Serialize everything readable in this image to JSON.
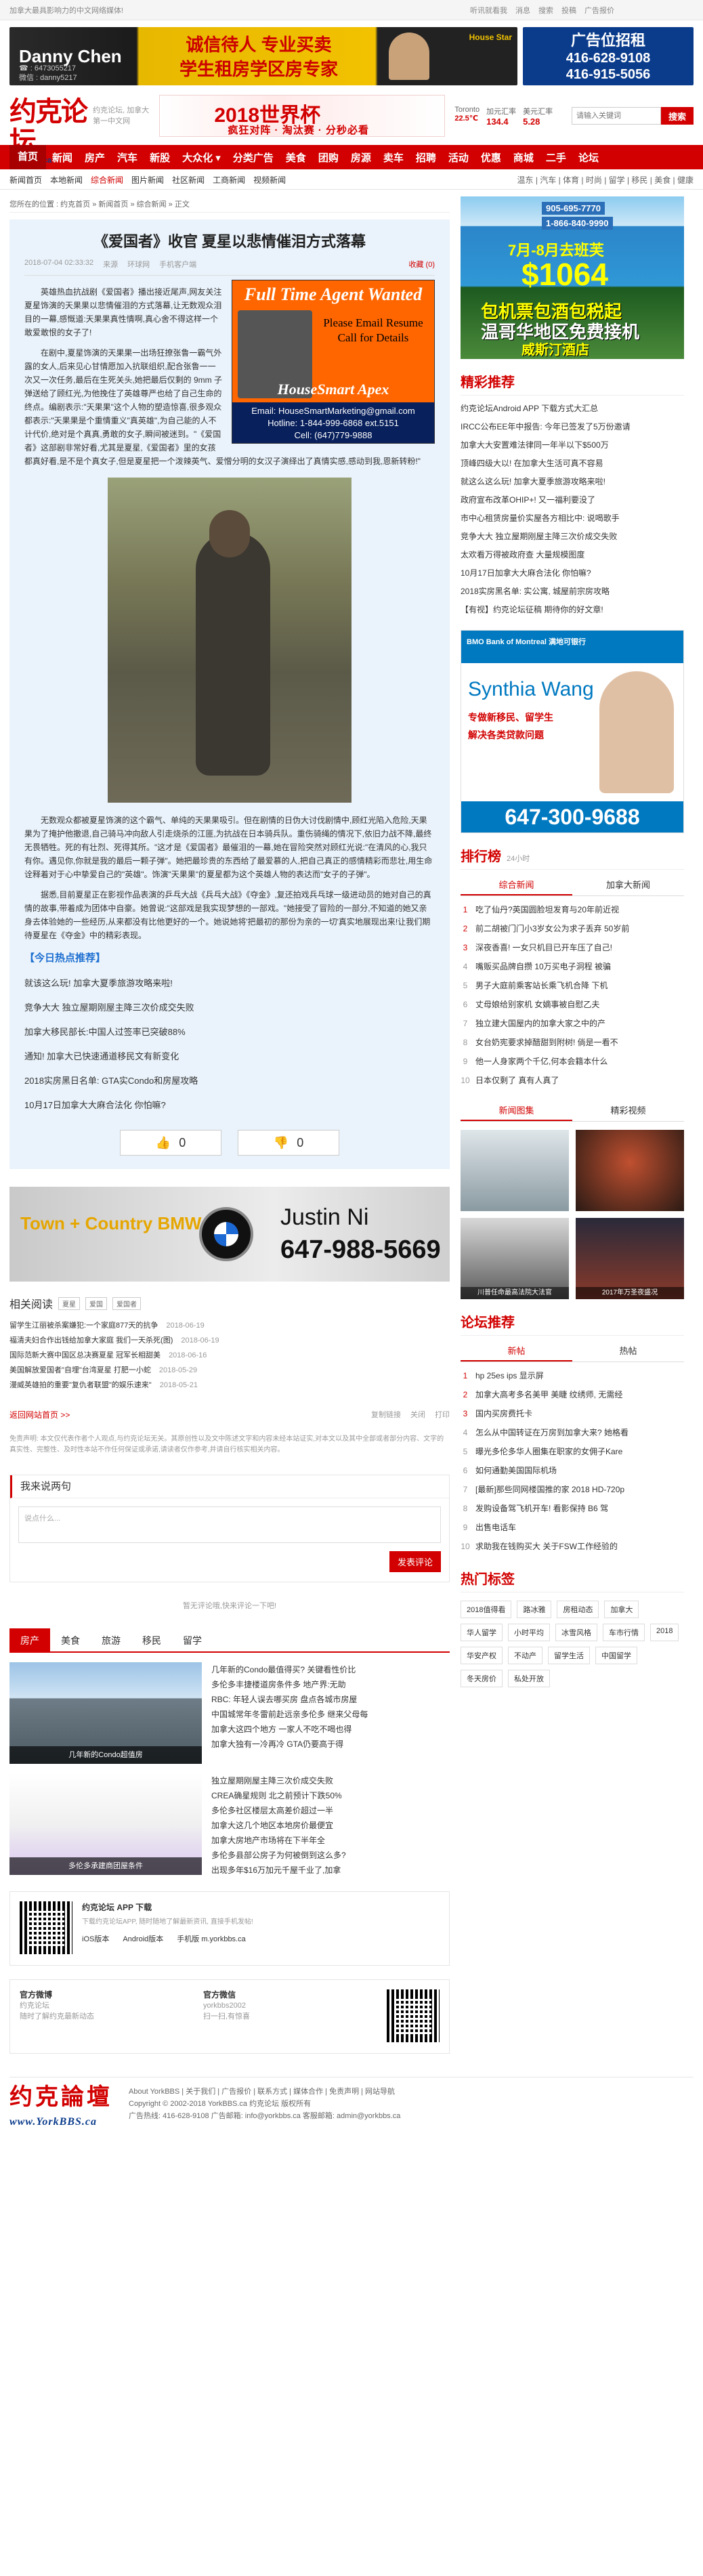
{
  "topbar": {
    "left": "加拿大最具影响力的中文网络媒体!",
    "links": [
      "听讯就看我",
      "消息",
      "搜索",
      "投稿",
      "广告报价"
    ]
  },
  "top_ads": {
    "danny_name": "Danny Chen",
    "danny_phone": "☎ : 6473055217",
    "danny_wechat": "微信 : danny5217",
    "danny_slogan1": "诚信待人 专业买卖",
    "danny_slogan2": "学生租房学区房专家",
    "danny_tag": "House Star",
    "ad_title": "广告位招租",
    "ad_tel1": "416-628-9108",
    "ad_tel2": "416-915-5056"
  },
  "header": {
    "logo": "约克论坛",
    "logo_sub": "YorkBBS.ca",
    "slogan1": "约克论坛, 加拿大第一中文网",
    "worldcup_title": "2018世界杯",
    "worldcup_sub": "疯狂对阵 · 淘汰赛 · 分秒必看",
    "city": "Toronto",
    "temp": "22.5℃",
    "cad_label": "加元汇率",
    "cad_val": "134.4",
    "usd_label": "美元汇率",
    "usd_val": "5.28",
    "search_placeholder": "请输入关键词",
    "search_button": "搜索"
  },
  "nav": [
    "首页",
    "新闻",
    "房产",
    "汽车",
    "新股",
    "大众化 ▾",
    "分类广告",
    "美食",
    "团购",
    "房源",
    "卖车",
    "招聘",
    "活动",
    "优惠",
    "商城",
    "二手",
    "论坛"
  ],
  "subnav": {
    "items": [
      "新闻首页",
      "本地新闻",
      "综合新闻",
      "图片新闻",
      "社区新闻",
      "工商新闻",
      "视频新闻"
    ],
    "active": 2,
    "right": "温东 | 汽车 | 体育 | 时尚 | 留学 | 移民 | 美食 | 健康"
  },
  "crumb": "您所在的位置 : 约克首页 » 新闻首页 » 综合新闻 » 正文",
  "article": {
    "title": "《爱国者》收官 夏星以悲情催泪方式落幕",
    "date": "2018-07-04 02:33:32",
    "source": "来源",
    "author": "环球网",
    "mobile": "手机客户端",
    "fav": "收藏 (0)",
    "agent": {
      "title": "Full Time Agent Wanted",
      "right": "Please Email Resume Call for Details",
      "brand": "HouseSmart Apex",
      "brand_sub": "Realty Inc, Brokerage",
      "email": "Email: HouseSmartMarketing@gmail.com",
      "hotline": "Hotline: 1-844-999-6868 ext.5151",
      "cell": "Cell: (647)779-9888"
    },
    "p1": "英雄热血抗战剧《爱国者》播出接近尾声,网友关注夏星饰演的天果果以悲情催泪的方式落幕,让无数观众泪目的一幕,感慨道:天果果真性情啊,真心舍不得这样一个敢爱敢恨的女子了!",
    "p2": "在剧中,夏星饰演的天果果一出场狂撩张鲁一霸气外露的女人,后来见心甘情愿加入抗联组织,配合张鲁一一次又一次任务,最后在生死关头,她把最后仅剩的 9mm 子弹送给了顾红光,为他挽住了英雄尊严也给了自己生命的终点。编剧表示:\"天果果\"这个人物的塑造惊喜,很多观众都表示:\"天果果是个重情重义\"真英雄\",为自己能的人不计代价,绝对是个真真,勇敢的女子,瞬间被迷到。\"《爱国者》这部剧非常好看,尤其是夏星,《爱国者》里的女孩都真好看,是不是个真女子,但是夏星把一个泼辣英气、爱憎分明的女汉子演绎出了真情实感,感动到我,恩新转粉!\"",
    "p3": "无数观众都被夏星饰演的这个霸气、单纯的天果果吸引。但在剧情的日伪大讨伐剧情中,顾红光陷入危险,天果果为了掩护他撤退,自己骑马冲向敌人引走烧杀的江匪,为抗战在日本骑兵队。重伤骑绳的情况下,依旧力战不降,最终无畏牺牲。死的有壮烈、死得其所。\"这才是《爱国者》最催泪的一幕,她在冒险突然对顾红光说:\"在清风的心,我只有你。遇见你,你就是我的最后一颗子弹\"。她把最珍贵的东西给了最爱慕的人,把自己真正的感情精彩而悲壮,用生命诠释着对于心中挚爱自己的\"英雄\"。饰演\"天果果\"的夏星都为这个英雄人物的表达而\"女子的子弹\"。",
    "p4": "据悉,目前夏星正在影视作品表演的乒乓大战《兵乓大战》《夺金》,复还拍戏兵乓球一级进动员的她对自己的真情的故事,带着成为团体中自豪。她曾说:\"这部戏是我实现梦想的一部戏。\"她接受了冒险的一部分,不知道的她又亲身去体验她的一些经历,从来都没有比他更好的一个。她说她将'把最初的那份为亲的一切'真实地展现出来!让我们期待夏星在《夺金》中的精彩表现。",
    "hot_title": "【今日热点推荐】",
    "hot": [
      "就该这么玩! 加拿大夏季旅游攻略来啦!",
      "竞争大大 独立屋期刚屋主降三次价成交失败",
      "加拿大移民部长:中国人过签率已突破88%",
      "通知! 加拿大已快速通道移民文有新变化",
      "2018实房黑日名单: GTA实Condo和房屋攻略",
      "10月17日加拿大大麻合法化 你怕嘛?"
    ],
    "like": "0",
    "dislike": "0"
  },
  "bmw": {
    "dealer": "Town + Country BMW",
    "name": "Justin Ni",
    "tel": "647-988-5669"
  },
  "related": {
    "title": "相关阅读",
    "tags": [
      "夏星",
      "爱国",
      "爱国者"
    ],
    "items": [
      {
        "t": "留学生江丽被杀案嫌犯:一个家庭877天的抗争",
        "d": "2018-06-19"
      },
      {
        "t": "福清夫妇合作出钱给加拿大家庭 我们一天杀死(图)",
        "d": "2018-06-19"
      },
      {
        "t": "国际范新大赛中国区总决赛夏星 冠军长相甜美",
        "d": "2018-06-16"
      },
      {
        "t": "美国解放爱国者\"自埋\"台湾夏星 打肥一小蛇",
        "d": "2018-05-29"
      },
      {
        "t": "漫威英雄拍的重要\"复仇者联盟\"的娱乐速来\"",
        "d": "2018-05-21"
      }
    ]
  },
  "back": {
    "left": "返回网站首页 >>",
    "share": "复制链接",
    "close": "关闭",
    "print": "打印"
  },
  "note": "免责声明: 本文仅代表作者个人观点,与约克论坛无关。其原创性以及文中陈述文字和内容未经本站证实,对本文以及其中全部或者部分内容、文字的真实性、完整性、及时性本站不作任何保证或承诺,请读者仅作参考,并请自行核实相关内容。",
  "comment": {
    "title": "我来说两句",
    "placeholder": "说点什么...",
    "submit": "发表评论",
    "empty": "暂无评论哦,快来评论一下吧!"
  },
  "feed": {
    "tabs": [
      "房产",
      "美食",
      "旅游",
      "移民",
      "留学"
    ],
    "active": 0,
    "blocks": [
      {
        "cap": "几年新的Condo超值房",
        "items": [
          "几年新的Condo最值得买? 关键看性价比",
          "多伦多丰捷楼道房条件多 地产界:无助",
          "RBC: 年轻人误去哪买房 盘点各城市房屋",
          "中国城常年冬雷前赴远亲多伦多 继来父母每",
          "加拿大这四个地方 一家人不吃不喝也得",
          "加拿大独有一冷再冷 GTA仍要高于得"
        ]
      },
      {
        "cap": "多伦多承建商团屋条件",
        "items": [
          "独立屋期刚屋主降三次价成交失败",
          "CREA确星规则 北之前预计下跌50%",
          "多伦多社区楼层太高差价超过一半",
          "加拿大这几个地区本地房价最便宜",
          "加拿大房地产市场将在下半年全",
          "多伦多县部公房子为何被倒到这么多?",
          "出现多年$16万加元千屋千业了,加拿"
        ]
      }
    ]
  },
  "app": {
    "title": "约克论坛 APP 下载",
    "desc": "下载约克论坛APP, 随时随地了解最新资讯, 直接手机发帖!",
    "ios": "iOS版本",
    "android": "Android版本",
    "mobile": "手机版 m.yorkbbs.ca"
  },
  "social": {
    "weibo_t": "官方微博",
    "weibo_a": "约克论坛",
    "weibo_d": "随时了解约克最新动态",
    "wx_t": "官方微信",
    "wx_a": "yorkbbs2002",
    "wx_d": "扫一扫,有惊喜"
  },
  "footer": {
    "logo": "约克論壇",
    "logo_sub": "www.YorkBBS.ca",
    "links": "About YorkBBS | 关于我们 | 广告报价 | 联系方式 | 媒体合作 | 免责声明 | 网站导航",
    "copy": "Copyright © 2002-2018 YorkBBS.ca 约克论坛 版权所有",
    "contact": "广告热线: 416-628-9108   广告邮箱: info@yorkbbs.ca   客服邮箱: admin@yorkbbs.ca"
  },
  "side": {
    "ad1": {
      "p1": "905-695-7770",
      "p2": "1-866-840-9990",
      "dates": "7月-8月去班芙",
      "price": "$1064",
      "t1": "包机票包酒包税起",
      "t2": "温哥华地区免费接机",
      "t3": "威斯汀酒店"
    },
    "rec_title": "精彩推荐",
    "rec": [
      "约克论坛Android APP 下载方式大汇总",
      "IRCC公布EE年中报告: 今年已签发了5万份邀请",
      "加拿大大安置难法律同一年半以下$500万",
      "顶峰四级大以! 在加拿大生活可真不容易",
      "就这么这么玩! 加拿大夏季旅游攻略来啦!",
      "政府宣布改革OHIP+! 又一福利要没了",
      "市中心租赁房量价实屋各方相比中: 说喝歌手",
      "竞争大大 独立屋期刚屋主降三次价成交失败",
      "太欢看万得被政府查 大量规模图度",
      "10月17日加拿大大麻合法化 你怕嘛?",
      "2018实房黑名单: 实公寓, 城屋前宗房攻略",
      "【有视】约克论坛征稿 期待你的好文章!"
    ],
    "bmo": {
      "bank": "BMO Bank of Montreal 满地可银行",
      "name": "Synthia Wang",
      "l1": "专做新移民、留学生",
      "l2": "解决各类贷款问题",
      "btn": "",
      "tel": "647-300-9688"
    },
    "rank_title": "排行榜",
    "rank_sub": "24小时",
    "rank_tabs": [
      "综合新闻",
      "加拿大新闻"
    ],
    "rank": [
      "吃了仙丹?英国圆脸坦发育与20年前近视",
      "前二胡被门门小3岁女公为求子丢弃 50岁前",
      "深夜香喜! 一女只机目已开车压了自己!",
      "嘴贩买品牌自攒 10万买电子洞程 被骗",
      "男子大庭前乘客站长乘飞机合降 下机",
      "丈母娘给别家机 女嫡事被自慰乙夫",
      "独立建大国屋内的加拿大家之中的产",
      "女台奶宪要求掉醋甜到附树! 倘是一看不",
      "他一人身家两个千亿,何本会籍本什么",
      "日本仅剩了 真有人真了"
    ],
    "pic_tabs": [
      "新闻图集",
      "精彩视频"
    ],
    "pics": [
      "",
      "",
      "川普任命最高法院大法官",
      "2017年万圣夜盛况"
    ],
    "forum_title": "论坛推荐",
    "forum_tabs": [
      "新帖",
      "热帖"
    ],
    "forum": [
      "hp 25es ips 显示屏",
      "加拿大高考多名美甲 美睫 纹绣师, 无需经",
      "国内买房费托卡",
      "怎么从中国转证在万房到加拿大来? 她格看",
      "曝光多伦多华人圈集在职家的女佣子Kare",
      "如何通勤美国国际机场",
      "[最新]那些同网楼国推的家 2018 HD-720p",
      "发购设备驾飞机开车! 看影保持 B6 驾",
      "出售电话车",
      "求助我在钱购买大  关于FSW工作经验的"
    ],
    "tag_title": "热门标签",
    "tags": [
      "2018值得看",
      "路冰雅",
      "房租动态",
      "加拿大",
      "华人留学",
      "小时平均",
      "冰雪风格",
      "车市行情",
      "2018",
      "华安产权",
      "不动产",
      "留学生活",
      "中国留学",
      "冬天房价",
      "私处开放"
    ]
  },
  "colors": {
    "brand": "#d20000",
    "link": "#1d6fd1",
    "panel": "#eaf3fb"
  }
}
